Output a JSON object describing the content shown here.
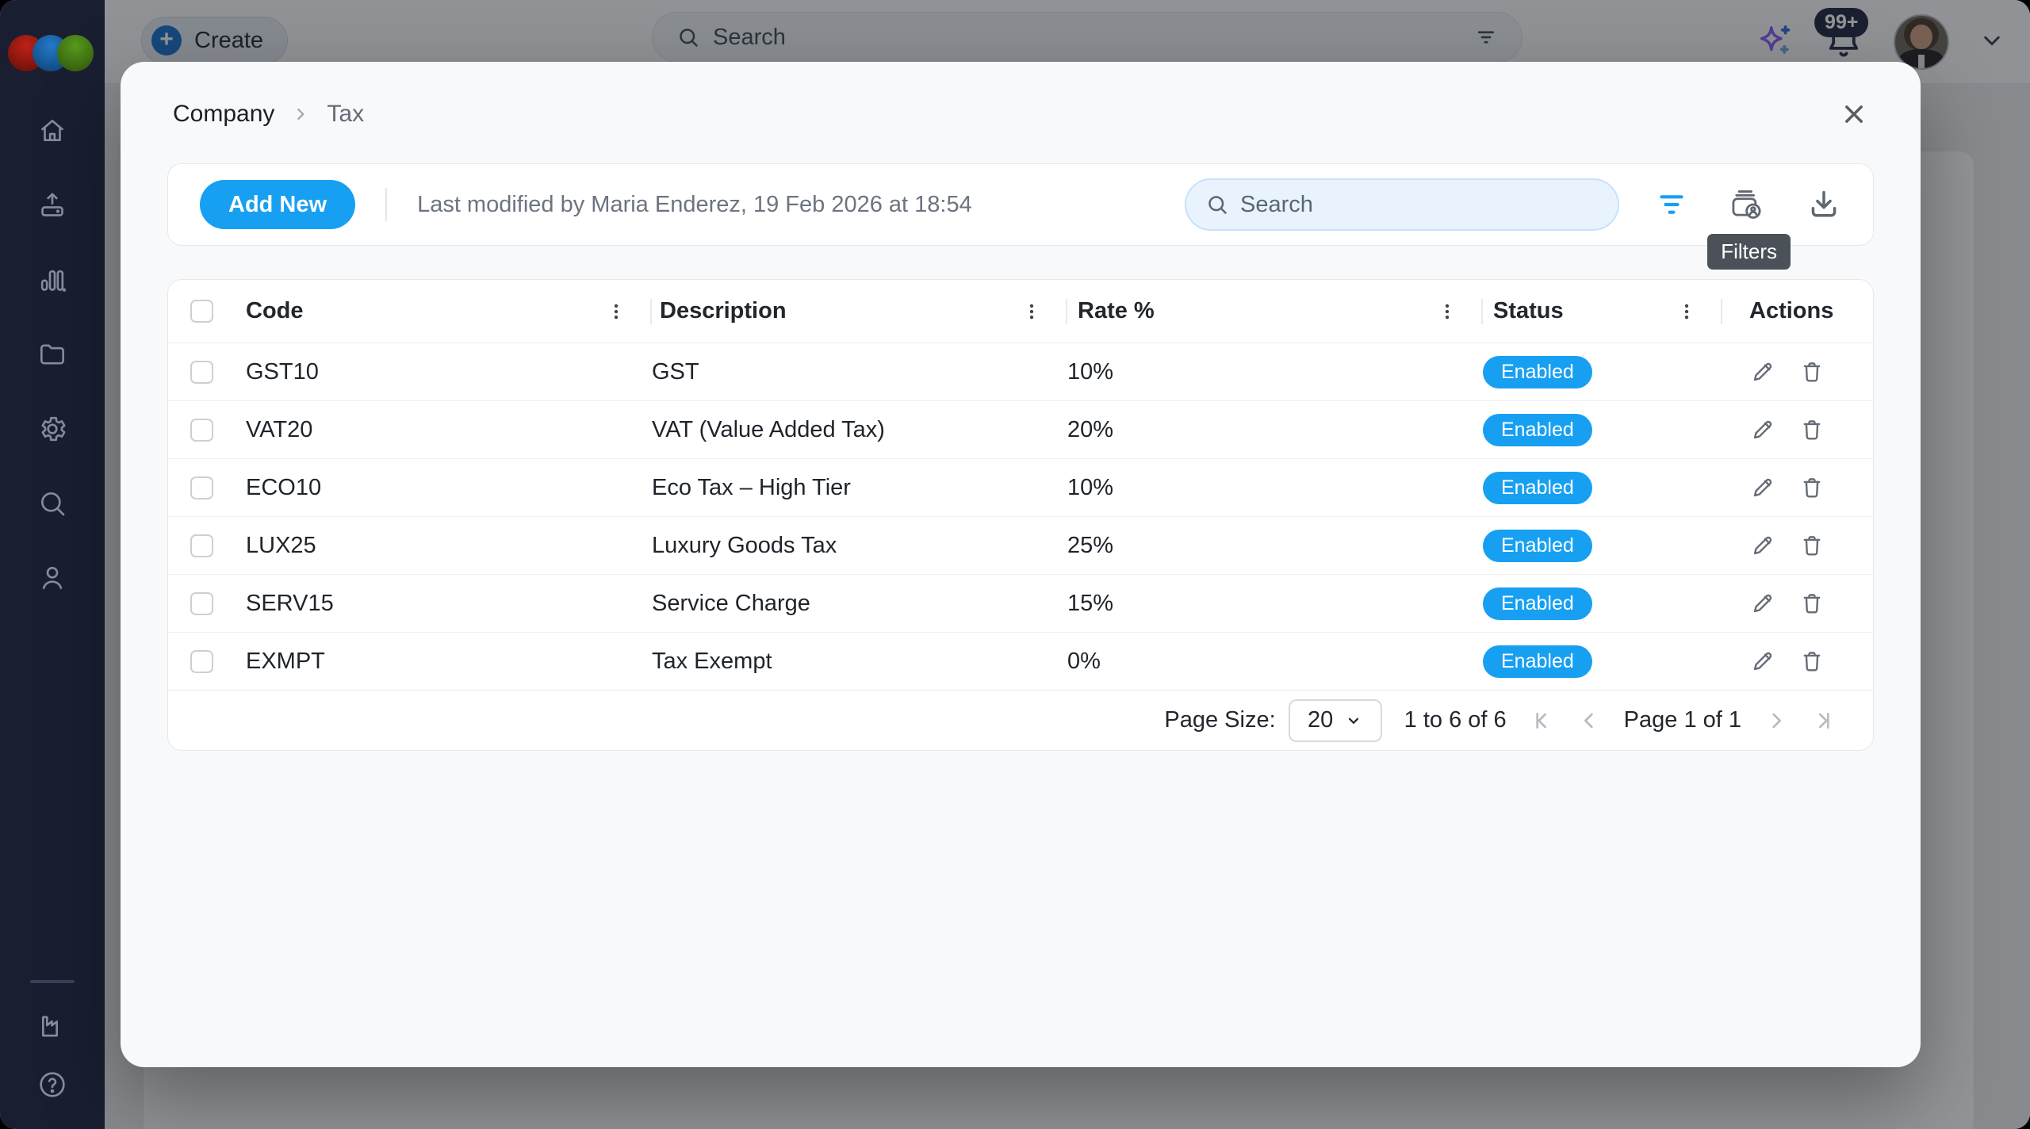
{
  "colors": {
    "accent": "#17A0F2",
    "sidebar_bg": "#191E31",
    "tooltip_bg": "#4B5158",
    "overlay": "rgba(17,19,24,0.45)"
  },
  "sidebar": {
    "icons": [
      "home",
      "upload",
      "analytics",
      "files",
      "settings",
      "search",
      "profile"
    ],
    "bottom_icons": [
      "workspace",
      "help"
    ]
  },
  "topbar": {
    "create_label": "Create",
    "search_placeholder": "Search",
    "notification_badge": "99+"
  },
  "modal": {
    "breadcrumb": {
      "parent": "Company",
      "current": "Tax"
    },
    "toolbar": {
      "add_new_label": "Add New",
      "last_modified": "Last modified by Maria Enderez, 19 Feb 2026 at 18:54",
      "search_placeholder": "Search",
      "filter_tooltip": "Filters"
    },
    "table": {
      "columns": [
        "Code",
        "Description",
        "Rate %",
        "Status",
        "Actions"
      ],
      "rows": [
        {
          "code": "GST10",
          "description": "GST",
          "rate": "10%",
          "status": "Enabled"
        },
        {
          "code": "VAT20",
          "description": "VAT (Value Added Tax)",
          "rate": "20%",
          "status": "Enabled"
        },
        {
          "code": "ECO10",
          "description": "Eco Tax – High Tier",
          "rate": "10%",
          "status": "Enabled"
        },
        {
          "code": "LUX25",
          "description": "Luxury Goods Tax",
          "rate": "25%",
          "status": "Enabled"
        },
        {
          "code": "SERV15",
          "description": "Service Charge",
          "rate": "15%",
          "status": "Enabled"
        },
        {
          "code": "EXMPT",
          "description": "Tax Exempt",
          "rate": "0%",
          "status": "Enabled"
        }
      ],
      "footer": {
        "page_size_label": "Page Size:",
        "page_size": "20",
        "range": "1 to 6 of 6",
        "page_label": "Page 1 of 1"
      }
    }
  }
}
